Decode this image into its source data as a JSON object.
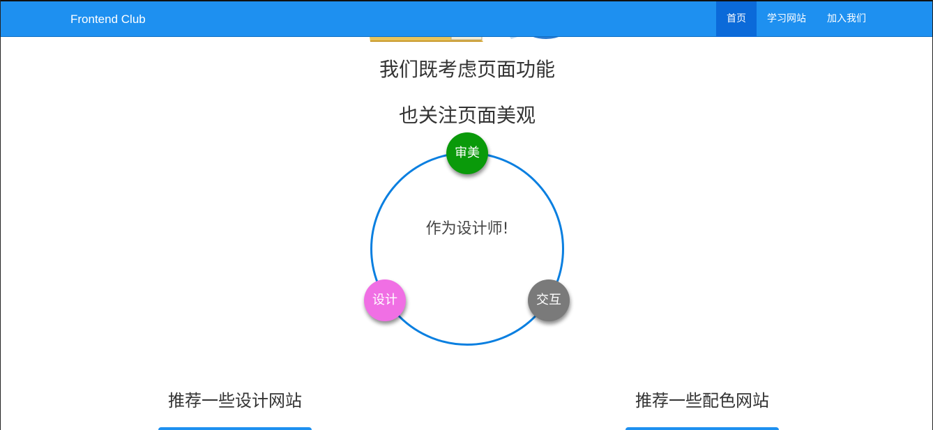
{
  "navbar": {
    "brand": "Frontend Club",
    "items": [
      {
        "label": "首页",
        "active": true
      },
      {
        "label": "学习网站",
        "active": false
      },
      {
        "label": "加入我们",
        "active": false
      }
    ],
    "color": "#1e90f0"
  },
  "hero": {
    "line1": "我们既考虑页面功能",
    "line2": "也关注页面美观"
  },
  "diagram": {
    "center_text": "作为设计师!",
    "bubbles": [
      {
        "label": "审美",
        "color": "#0a9a0a"
      },
      {
        "label": "设计",
        "color": "#f06fe4"
      },
      {
        "label": "交互",
        "color": "#7a7a7a"
      }
    ],
    "ring_color": "#0a7fe0"
  },
  "sections": {
    "left_title": "推荐一些设计网站",
    "right_title": "推荐一些配色网站"
  }
}
